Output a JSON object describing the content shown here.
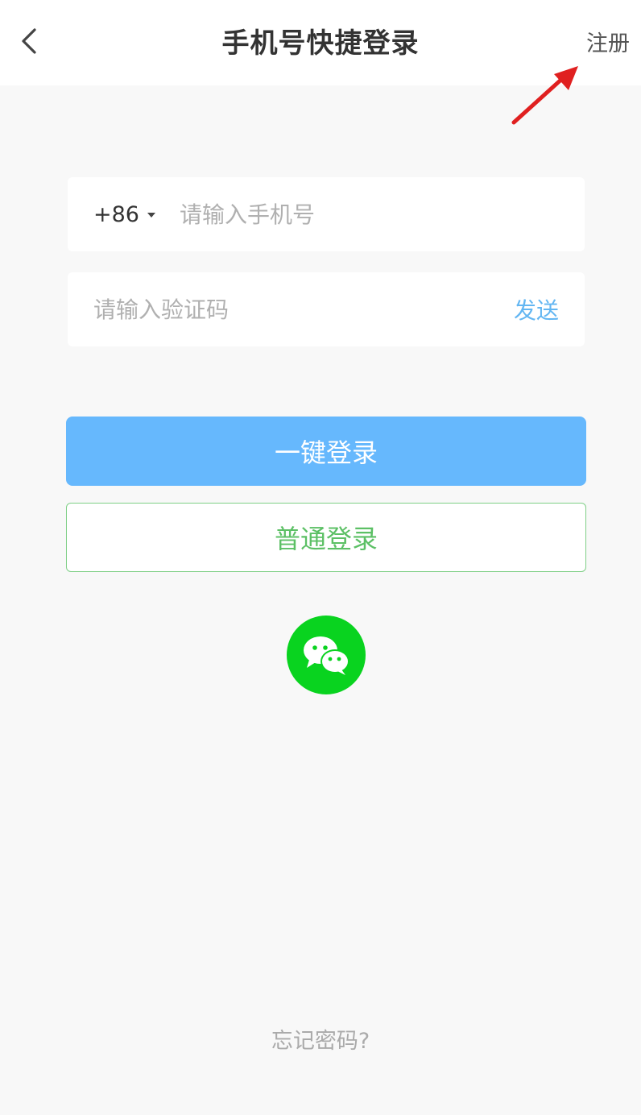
{
  "header": {
    "title": "手机号快捷登录",
    "register_label": "注册",
    "back_icon": "chevron-left-icon"
  },
  "phone": {
    "country_code": "+86",
    "placeholder": "请输入手机号",
    "value": ""
  },
  "code": {
    "placeholder": "请输入验证码",
    "value": "",
    "send_label": "发送"
  },
  "actions": {
    "one_click_login": "一键登录",
    "normal_login": "普通登录",
    "wechat_icon": "wechat-icon"
  },
  "footer": {
    "forgot_password": "忘记密码?"
  },
  "colors": {
    "primary_blue": "#66b8fd",
    "link_blue": "#63b6f2",
    "secondary_green": "#5cc065",
    "wechat_green": "#09d31f",
    "annotation_red": "#e02020"
  }
}
